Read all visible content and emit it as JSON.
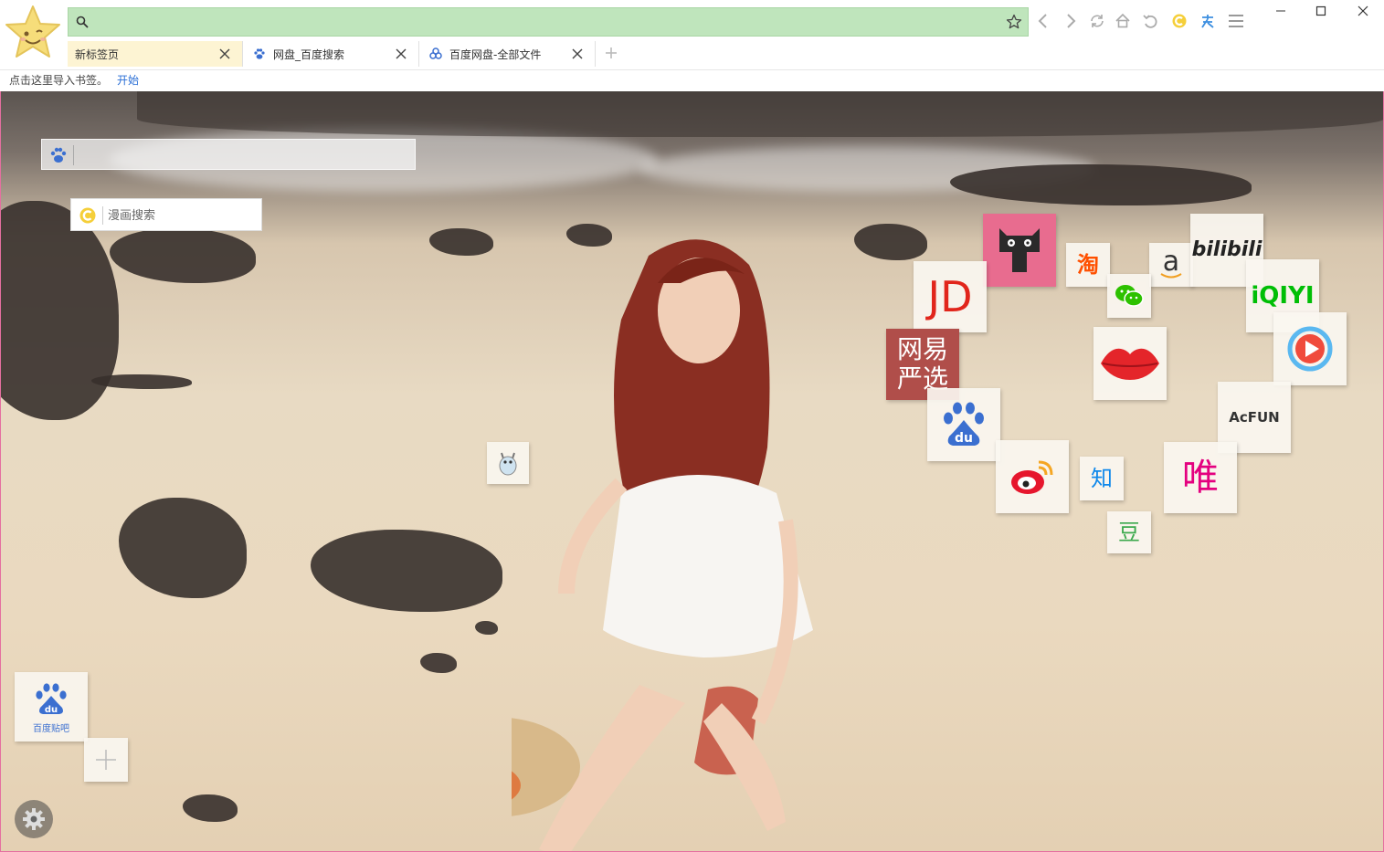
{
  "tabs": [
    {
      "label": "新标签页",
      "active": true,
      "icon": "none"
    },
    {
      "label": "网盘_百度搜索",
      "active": false,
      "icon": "baidu-paw-icon"
    },
    {
      "label": "百度网盘-全部文件",
      "active": false,
      "icon": "baidu-netdisk-icon"
    }
  ],
  "address": {
    "value": "",
    "placeholder": ""
  },
  "bookmark_bar": {
    "text": "点击这里导入书签。",
    "link": "开始"
  },
  "search": {
    "baidu_placeholder": "",
    "comic_placeholder": "漫画搜索"
  },
  "tiles": {
    "tmall": "tmall-cat-icon",
    "jd": "JD",
    "taobao": "淘",
    "amazon": "a",
    "wechat": "wechat-icon",
    "bilibili": "bilibili",
    "iqiyi": "iQIYI",
    "youku": "play-icon",
    "netease_line1": "网易",
    "netease_line2": "严选",
    "lips": "lips-icon",
    "acfun": "AcFUN",
    "baidu": "du",
    "weibo": "weibo-icon",
    "zhihu": "知",
    "vip": "唯",
    "douban": "豆"
  },
  "bottom_left": {
    "tieba_label": "百度贴吧",
    "tieba_logo": "du"
  },
  "colors": {
    "address_bg": "#bfe5bc",
    "active_tab": "#fdf4d3",
    "tmall_bg": "#e86c8f",
    "jd_red": "#e1251b",
    "netease_bg": "#b04e4a",
    "baidu_blue": "#3b6fd0",
    "iqiyi_green": "#00be06",
    "vip_pink": "#e4007f",
    "zhihu_blue": "#0f88eb",
    "douban_green": "#3ba94d",
    "border_pink": "#e56fa0"
  }
}
